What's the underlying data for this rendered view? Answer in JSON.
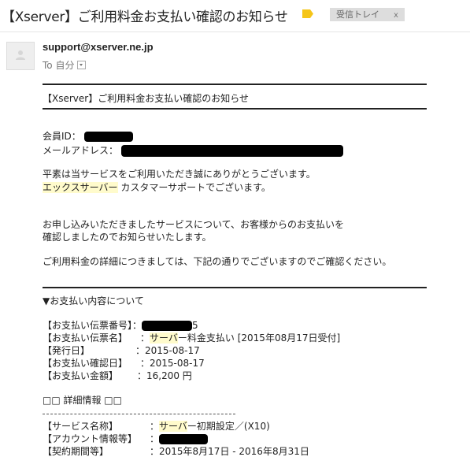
{
  "header": {
    "subject": "【Xserver】ご利用料金お支払い確認のお知らせ",
    "label_tag": "受信トレイ",
    "label_close": "x"
  },
  "colors": {
    "label_icon": "#f5c518",
    "highlight": "#fffbcc",
    "redaction": "#000000"
  },
  "message": {
    "sender": "support@xserver.ne.jp",
    "to": "To 自分"
  },
  "body": {
    "title": "【Xserver】ご利用料金お支払い確認のお知らせ",
    "member_id_label": "会員ID：",
    "email_label": "メールアドレス：",
    "greeting_1": "平素は当サービスをご利用いただき誠にありがとうございます。",
    "greeting_2a": "エックスサーバー",
    "greeting_2b": " カスタマーサポートでございます。",
    "para_1": "お申し込みいただきましたサービスについて、お客様からのお支払いを",
    "para_2": "確認しましたのでお知らせいたします。",
    "para_3": "ご利用料金の詳細につきましては、下記の通りでございますのでご確認ください。",
    "section_title": "▼お支払い内容について",
    "payment_fields": [
      {
        "label": "【お支払い伝票番号】：",
        "value_suffix": "5"
      },
      {
        "label": "【お支払い伝票名】",
        "value_pre": "：",
        "value_hl": "サーバ",
        "value_post": "ー料金支払い [2015年08月17日受付]"
      },
      {
        "label": "【発行日】",
        "value": "：2015-08-17"
      },
      {
        "label": "【お支払い確認日】",
        "value": "：2015-08-17"
      },
      {
        "label": "【お支払い金額】",
        "value": "：16,200 円"
      }
    ],
    "detail_title": "□□ 詳細情報 □□",
    "detail_fields": [
      {
        "label": "【サービス名称】",
        "value_pre": "：",
        "value_hl": "サーバ",
        "value_post": "ー初期設定／(X10)"
      },
      {
        "label": "【アカウント情報等】",
        "value": "："
      },
      {
        "label": "【契約期間等】",
        "value": "：2015年8月17日 - 2016年8月31日"
      }
    ]
  }
}
